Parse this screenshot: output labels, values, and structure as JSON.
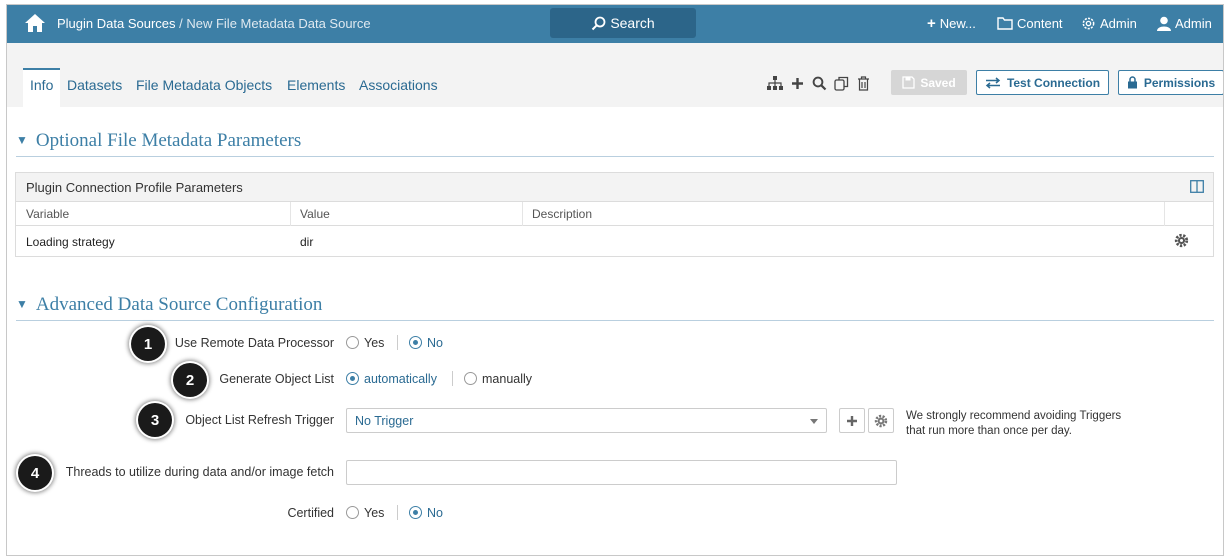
{
  "topbar": {
    "breadcrumb_root": "Plugin Data Sources",
    "breadcrumb_sep": " / ",
    "breadcrumb_current": "New File Metadata Data Source",
    "search_label": "Search",
    "new_label": "New...",
    "content_label": "Content",
    "admin_menu_label": "Admin",
    "user_label": "Admin",
    "bar_color": "#3d7fa6"
  },
  "tabs": [
    {
      "label": "Info",
      "active": true
    },
    {
      "label": "Datasets"
    },
    {
      "label": "File Metadata Objects"
    },
    {
      "label": "Elements"
    },
    {
      "label": "Associations"
    }
  ],
  "toolbar": {
    "icons": [
      "hierarchy-icon",
      "plus-icon",
      "search-icon",
      "copy-icon",
      "trash-icon"
    ],
    "saved_label": "Saved",
    "test_connection_label": "Test Connection",
    "permissions_label": "Permissions"
  },
  "optional_section": {
    "title": "Optional File Metadata Parameters",
    "grid_title": "Plugin Connection Profile Parameters",
    "columns": [
      "Variable",
      "Value",
      "Description"
    ],
    "rows": [
      {
        "variable": "Loading strategy",
        "value": "dir",
        "description": ""
      }
    ]
  },
  "advanced_section": {
    "title": "Advanced Data Source Configuration",
    "remote_processor": {
      "label": "Use Remote Data Processor",
      "options": [
        "Yes",
        "No"
      ],
      "selected": "No"
    },
    "object_list": {
      "label": "Generate Object List",
      "options": [
        "automatically",
        "manually"
      ],
      "selected": "automatically"
    },
    "refresh_trigger": {
      "label": "Object List Refresh Trigger",
      "value": "No Trigger",
      "hint_line1": "We strongly recommend avoiding Triggers",
      "hint_line2": "that run more than once per day."
    },
    "threads": {
      "label": "Threads to utilize during data and/or image fetch",
      "value": ""
    },
    "certified": {
      "label": "Certified",
      "options": [
        "Yes",
        "No"
      ],
      "selected": "No"
    }
  },
  "callouts": [
    "1",
    "2",
    "3",
    "4"
  ]
}
